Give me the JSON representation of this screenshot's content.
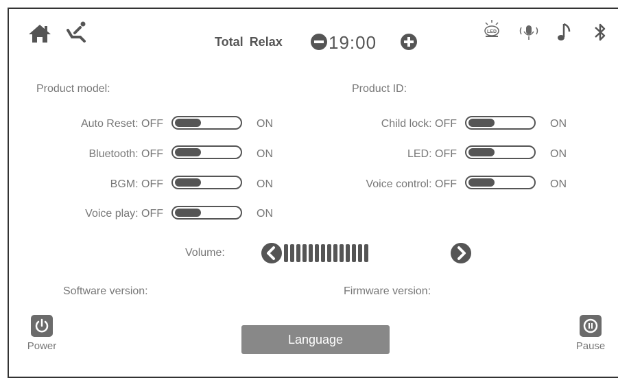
{
  "header": {
    "title_part1": "Total",
    "title_part2": "Relax",
    "timer": "19:00",
    "icons": [
      "home-icon",
      "recline-icon",
      "led-icon",
      "voice-icon",
      "music-icon",
      "bluetooth-icon"
    ]
  },
  "info": {
    "product_model_label": "Product model:",
    "product_id_label": "Product ID:",
    "software_version_label": "Software version:",
    "firmware_version_label": "Firmware version:"
  },
  "settings": {
    "off_text": "OFF",
    "on_text": "ON",
    "auto_reset": "Auto Reset:",
    "bluetooth": "Bluetooth:",
    "bgm": "BGM:",
    "voice_play": "Voice play:",
    "child_lock": "Child lock:",
    "led": "LED:",
    "voice_control": "Voice control:"
  },
  "volume": {
    "label": "Volume:",
    "bars": 14
  },
  "buttons": {
    "power": "Power",
    "language": "Language",
    "pause": "Pause"
  },
  "colors": {
    "accent": "#555555",
    "button_bg": "#888888",
    "text": "#777777"
  }
}
